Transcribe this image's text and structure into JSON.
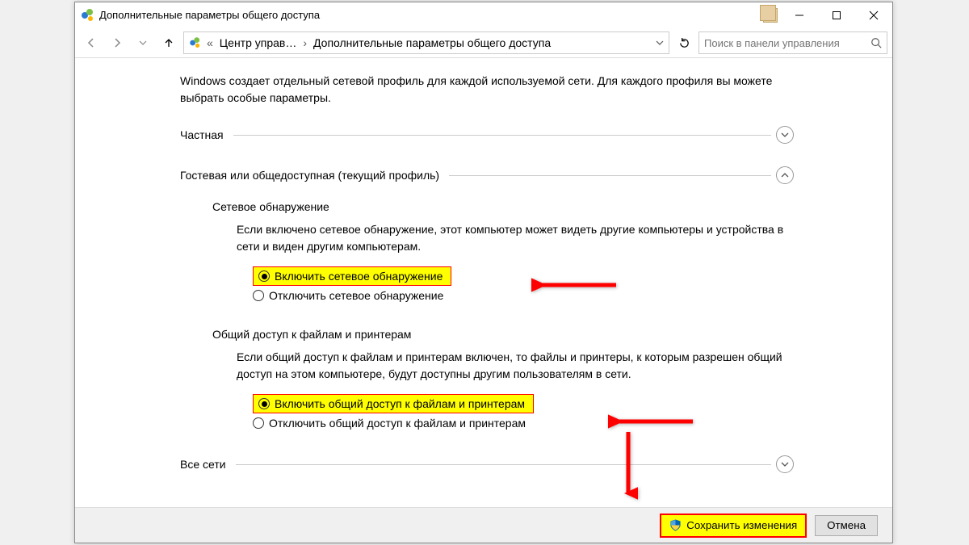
{
  "window": {
    "title": "Дополнительные параметры общего доступа"
  },
  "breadcrumb": {
    "seg1": "Центр управ…",
    "seg2": "Дополнительные параметры общего доступа"
  },
  "search": {
    "placeholder": "Поиск в панели управления"
  },
  "intro": "Windows создает отдельный сетевой профиль для каждой используемой сети. Для каждого профиля вы можете выбрать особые параметры.",
  "sections": {
    "private": {
      "label": "Частная"
    },
    "guest": {
      "label": "Гостевая или общедоступная (текущий профиль)"
    },
    "all": {
      "label": "Все сети"
    }
  },
  "discovery": {
    "title": "Сетевое обнаружение",
    "desc": "Если включено сетевое обнаружение, этот компьютер может видеть другие компьютеры и устройства в сети и виден другим компьютерам.",
    "enable": "Включить сетевое обнаружение",
    "disable": "Отключить сетевое обнаружение"
  },
  "sharing": {
    "title": "Общий доступ к файлам и принтерам",
    "desc": "Если общий доступ к файлам и принтерам включен, то файлы и принтеры, к которым разрешен общий доступ на этом компьютере, будут доступны другим пользователям в сети.",
    "enable": "Включить общий доступ к файлам и принтерам",
    "disable": "Отключить общий доступ к файлам и принтерам"
  },
  "footer": {
    "save": "Сохранить изменения",
    "cancel": "Отмена"
  }
}
